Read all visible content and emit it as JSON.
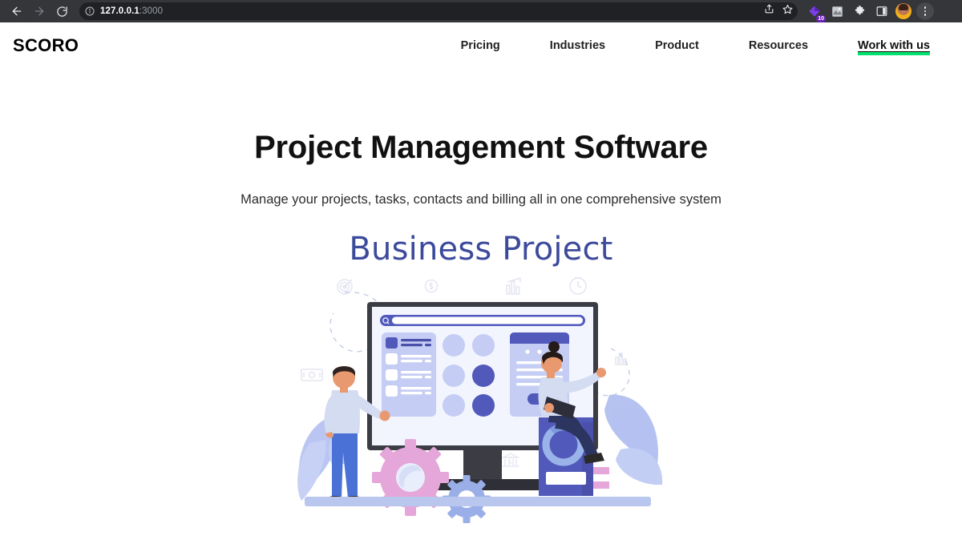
{
  "browser": {
    "back_icon": "arrow-left-icon",
    "forward_icon": "arrow-right-icon",
    "reload_icon": "reload-icon",
    "site_info_icon": "info-circle-icon",
    "url_host": "127.0.0.1",
    "url_port": ":3000",
    "share_icon": "share-icon",
    "bookmark_icon": "star-icon",
    "extension_badge_count": "10",
    "extension_1_icon": "purple-diamond-extension-icon",
    "extension_2_icon": "grayscale-extension-icon",
    "puzzle_icon": "puzzle-piece-icon",
    "side_panel_icon": "side-panel-icon",
    "avatar_icon": "profile-avatar",
    "menu_icon": "three-dot-menu-icon",
    "chrome_bg": "#35363a",
    "omnibox_bg": "#202124"
  },
  "site": {
    "logo": "SCORO",
    "nav": [
      {
        "label": "Pricing",
        "highlight": false
      },
      {
        "label": "Industries",
        "highlight": false
      },
      {
        "label": "Product",
        "highlight": false
      },
      {
        "label": "Resources",
        "highlight": false
      },
      {
        "label": "Work with us",
        "highlight": true
      }
    ],
    "highlight_color": "#00e16f"
  },
  "hero": {
    "title": "Project Management Software",
    "subtitle": "Manage your projects, tasks, contacts and billing all in one comprehensive system"
  },
  "illustration": {
    "title": "Business Project",
    "title_color": "#3c4a9c",
    "alt": "business-project-illustration",
    "decor_icons": [
      "target-icon",
      "dollar-coin-icon",
      "bar-chart-icon",
      "clock-icon",
      "money-note-icon",
      "small-bar-chart-icon",
      "bank-icon"
    ],
    "palette": {
      "light_periwinkle": "#bdc7f2",
      "periwinkle": "#a8b4ee",
      "indigo": "#5159bb",
      "deep_indigo": "#4b51ab",
      "pink_gear": "#e5a6d9",
      "blue_gear": "#9aafe8",
      "leaf_blue": "#aebcf0",
      "ground": "#b9c7ef",
      "monitor_frame": "#3c3c44",
      "skin": "#e8996f",
      "jeans": "#4a72d6",
      "dark_navy": "#2c3560"
    }
  }
}
